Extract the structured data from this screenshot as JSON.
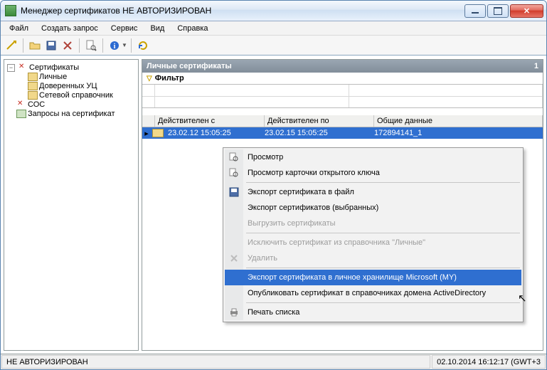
{
  "window": {
    "title": "Менеджер сертификатов  НЕ АВТОРИЗИРОВАН"
  },
  "menu": {
    "file": "Файл",
    "create_request": "Создать запрос",
    "service": "Сервис",
    "view": "Вид",
    "help": "Справка"
  },
  "tree": {
    "root": "Сертификаты",
    "personal": "Личные",
    "trusted_ca": "Доверенных УЦ",
    "directory": "Сетевой справочник",
    "crl": "СОС",
    "requests": "Запросы на сертификат"
  },
  "panel": {
    "title": "Личные сертификаты",
    "count": "1",
    "filter_label": "Фильтр"
  },
  "grid": {
    "headers": {
      "valid_from": "Действителен с",
      "valid_to": "Действителен по",
      "common_data": "Общие данные"
    },
    "rows": [
      {
        "valid_from": "23.02.12 15:05:25",
        "valid_to": "23.02.15 15:05:25",
        "common_data": "172894141_1"
      }
    ]
  },
  "context_menu": {
    "view": "Просмотр",
    "view_key_card": "Просмотр карточки открытого ключа",
    "export_to_file": "Экспорт сертификата в файл",
    "export_selected": "Экспорт сертификатов (выбранных)",
    "unload": "Выгрузить сертификаты",
    "exclude_from_personal": "Исключить сертификат из справочника \"Личные\"",
    "delete": "Удалить",
    "export_to_my": "Экспорт сертификата в личное хранилище Microsoft (MY)",
    "publish_ad": "Опубликовать сертификат в справочниках домена ActiveDirectory",
    "print_list": "Печать списка"
  },
  "status": {
    "left": "НЕ АВТОРИЗИРОВАН",
    "right": "02.10.2014 16:12:17 (GWT+3"
  },
  "icons": {
    "open": "open-icon",
    "save": "save-icon",
    "delete": "delete-icon",
    "preview": "preview-icon",
    "info": "info-icon",
    "refresh": "refresh-icon"
  }
}
